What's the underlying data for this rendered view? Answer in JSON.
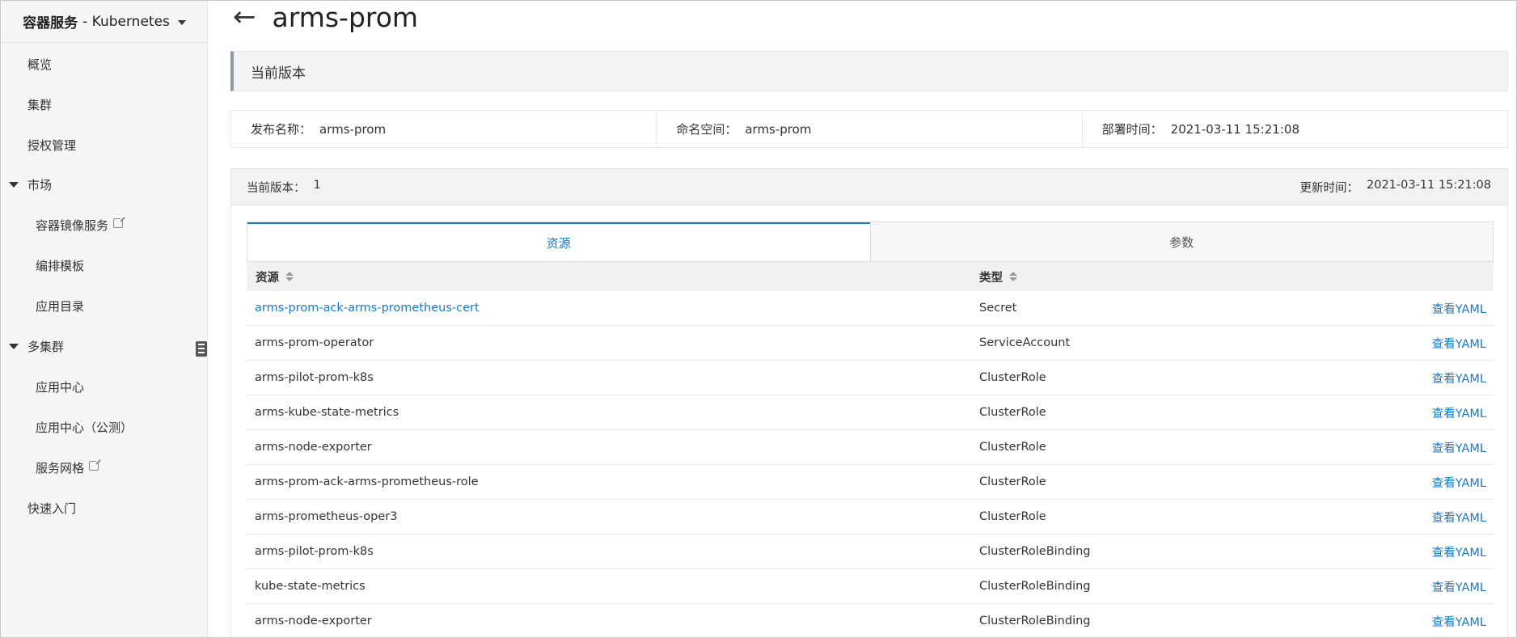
{
  "sidebar": {
    "brand_main": "容器服务",
    "brand_sub": "- Kubernetes",
    "items": [
      {
        "label": "概览"
      },
      {
        "label": "集群"
      },
      {
        "label": "授权管理"
      },
      {
        "label": "市场"
      },
      {
        "label": "容器镜像服务"
      },
      {
        "label": "编排模板"
      },
      {
        "label": "应用目录"
      },
      {
        "label": "多集群"
      },
      {
        "label": "应用中心"
      },
      {
        "label": "应用中心（公测）"
      },
      {
        "label": "服务网格"
      },
      {
        "label": "快速入门"
      }
    ]
  },
  "header": {
    "back_icon": "←",
    "title": "arms-prom"
  },
  "section": {
    "title": "当前版本"
  },
  "info": {
    "release_name_label": "发布名称：",
    "release_name_value": "arms-prom",
    "namespace_label": "命名空间：",
    "namespace_value": "arms-prom",
    "deploy_time_label": "部署时间：",
    "deploy_time_value": "2021-03-11 15:21:08"
  },
  "version_bar": {
    "version_label": "当前版本：",
    "version_value": "1",
    "updated_label": "更新时间：",
    "updated_value": "2021-03-11 15:21:08"
  },
  "tabs": [
    {
      "label": "资源",
      "active": true
    },
    {
      "label": "参数",
      "active": false
    }
  ],
  "table": {
    "headers": {
      "resource": "资源",
      "type": "类型"
    },
    "action_label": "查看YAML",
    "rows": [
      {
        "resource": "arms-prom-ack-arms-prometheus-cert",
        "type": "Secret",
        "action": "查看YAML"
      },
      {
        "resource": "arms-prom-operator",
        "type": "ServiceAccount",
        "action": "查看YAML"
      },
      {
        "resource": "arms-pilot-prom-k8s",
        "type": "ClusterRole",
        "action": "查看YAML"
      },
      {
        "resource": "arms-kube-state-metrics",
        "type": "ClusterRole",
        "action": "查看YAML"
      },
      {
        "resource": "arms-node-exporter",
        "type": "ClusterRole",
        "action": "查看YAML"
      },
      {
        "resource": "arms-prom-ack-arms-prometheus-role",
        "type": "ClusterRole",
        "action": "查看YAML"
      },
      {
        "resource": "arms-prometheus-oper3",
        "type": "ClusterRole",
        "action": "查看YAML"
      },
      {
        "resource": "arms-pilot-prom-k8s",
        "type": "ClusterRoleBinding",
        "action": "查看YAML"
      },
      {
        "resource": "kube-state-metrics",
        "type": "ClusterRoleBinding",
        "action": "查看YAML"
      },
      {
        "resource": "arms-node-exporter",
        "type": "ClusterRoleBinding",
        "action": "查看YAML"
      }
    ]
  },
  "colors": {
    "accent": "#1778cb",
    "sidebar_bg": "#f5f5f5",
    "section_border": "#8b98a5"
  }
}
